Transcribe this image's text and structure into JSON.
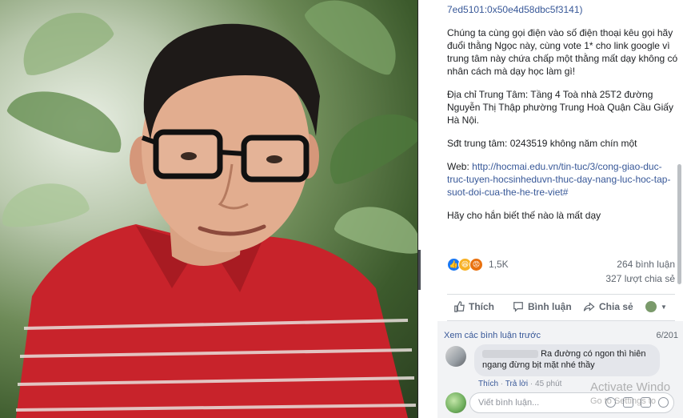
{
  "post": {
    "text_top": "7ed5101:0x50e4d58dbc5f3141)",
    "para1": "Chúng ta cùng gọi điện vào số điện thoại kêu gọi hãy đuổi thằng Ngọc này, cùng vote 1* cho link google vì trung tâm này chứa chấp một thằng mất dạy không có nhân cách mà dạy học làm gì!",
    "para2": "Địa chỉ Trung Tâm: Tầng 4 Toà nhà 25T2 đường Nguyễn Thị Thập phường Trung Hoà Quận Cầu Giấy Hà Nội.",
    "para3": "Sđt trung tâm: 0243519 không năm chín một",
    "web_label": "Web:",
    "web_link": "http://hocmai.edu.vn/tin-tuc/3/cong-giao-duc-truc-tuyen-hocsinheduvn-thuc-day-nang-luc-hoc-tap-suot-doi-cua-the-he-tre-viet#",
    "para5": "Hãy cho hắn biết thế nào là mất dạy"
  },
  "stats": {
    "reactions": "1,5K",
    "comments": "264 bình luận",
    "shares": "327 lượt chia sẻ"
  },
  "actions": {
    "like": "Thích",
    "comment": "Bình luận",
    "share": "Chia sẻ"
  },
  "comments": {
    "view_previous": "Xem các bình luận trước",
    "count": "6/201",
    "first_text": "Ra đường có ngon thì hiên ngang đừng bịt mặt nhé thầy",
    "meta_like": "Thích",
    "meta_reply": "Trả lời",
    "meta_time": "45 phút",
    "input_placeholder": "Viết bình luận..."
  },
  "watermark": {
    "title": "Activate Windo",
    "sub": "Go to Settings to"
  },
  "colors": {
    "link": "#385898",
    "text": "#1c1e21",
    "muted": "#606770",
    "shirt": "#c8232b"
  }
}
